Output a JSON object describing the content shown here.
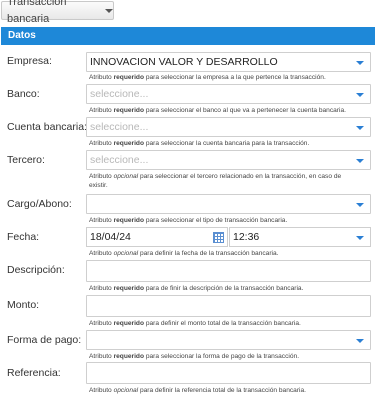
{
  "toolbar": {
    "menu_label": "Transacción bancaria"
  },
  "panel": {
    "title": "Datos"
  },
  "fields": {
    "empresa": {
      "label": "Empresa:",
      "value": "INNOVACION VALOR Y DESARROLLO",
      "help_pre": "Atributo ",
      "help_em": "requerido",
      "help_post": " para seleccionar la empresa a la que pertence la transacción."
    },
    "banco": {
      "label": "Banco:",
      "placeholder": "seleccione...",
      "help_pre": "Atributo ",
      "help_em": "requerido",
      "help_post": " para seleccionar el banco al que va a pertenecer la cuenta bancaria."
    },
    "cuenta": {
      "label": "Cuenta bancaria:",
      "placeholder": "seleccione...",
      "help_pre": "Atributo ",
      "help_em": "requerido",
      "help_post": " para seleccionar la cuenta bancaria para la transacción."
    },
    "tercero": {
      "label": "Tercero:",
      "placeholder": "seleccione...",
      "help_pre": "Atributo ",
      "help_em": "opcional",
      "help_post": " para seleccionar el tercero relacionado en la transacción, en caso de existir."
    },
    "cargo": {
      "label": "Cargo/Abono:",
      "value": "",
      "help_pre": "Atributo ",
      "help_em": "requerido",
      "help_post": " para seleccionar el tipo de transacción bancaria."
    },
    "fecha": {
      "label": "Fecha:",
      "date": "18/04/24",
      "time": "12:36",
      "help_pre": "Atributo ",
      "help_em": "opcional",
      "help_post": " para definir la fecha de la transacción bancaria."
    },
    "descripcion": {
      "label": "Descripción:",
      "value": "",
      "help_pre": "Atributo ",
      "help_em": "requerido",
      "help_post": " para de finir la descripción de la transacción bancaria."
    },
    "monto": {
      "label": "Monto:",
      "value": "",
      "help_pre": "Atributo ",
      "help_em": "requerido",
      "help_post": " para definir el monto total de la transacción bancaria."
    },
    "forma_pago": {
      "label": "Forma de pago:",
      "value": "",
      "help_pre": "Atributo ",
      "help_em": "requerido",
      "help_post": " para seleccionar la forma de pago de la transacción."
    },
    "referencia": {
      "label": "Referencia:",
      "value": "",
      "help_pre": "Atributo ",
      "help_em": "opcional",
      "help_post": " para definir la referencia total de la transacción bancaria."
    }
  }
}
